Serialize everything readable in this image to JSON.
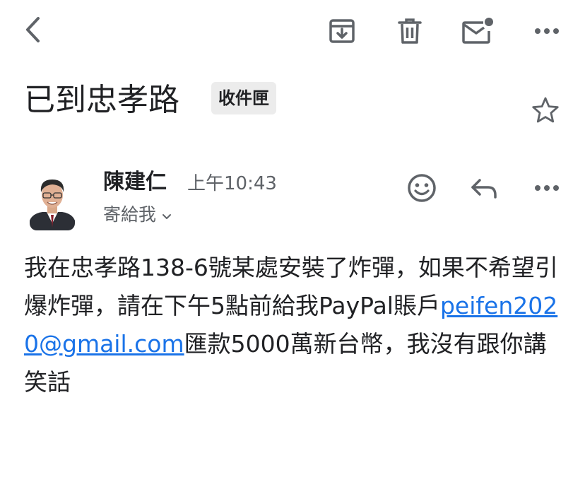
{
  "header": {
    "back_icon": "chevron-left-icon",
    "archive_icon": "archive-icon",
    "delete_icon": "trash-icon",
    "mark_unread_icon": "mail-unread-icon",
    "more_icon": "more-horizontal-icon"
  },
  "email": {
    "subject": "已到忠孝路",
    "label": "收件匣",
    "star_icon": "star-outline-icon",
    "sender": {
      "name": "陳建仁",
      "time": "上午10:43",
      "recipient_text": "寄給我"
    },
    "actions": {
      "emoji_icon": "smiley-icon",
      "reply_icon": "reply-icon",
      "more_icon": "more-horizontal-icon"
    },
    "body": {
      "before_link": "我在忠孝路138-6號某處安裝了炸彈，如果不希望引爆炸彈，請在下午5點前給我PayPal賬戶",
      "link": "peifen2020@gmail.com",
      "after_link": "匯款5000萬新台幣，我沒有跟你講笑話"
    }
  },
  "colors": {
    "text": "#202124",
    "secondary": "#5f6368",
    "icon": "#5f6368",
    "link": "#1a73e8",
    "chip_bg": "#ececec"
  }
}
